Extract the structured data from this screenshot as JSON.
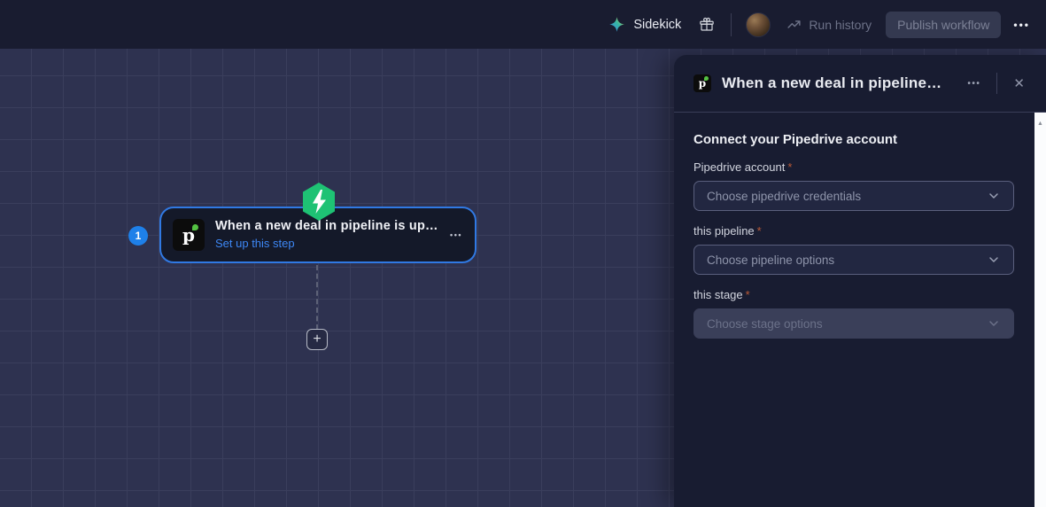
{
  "topbar": {
    "sidekick_label": "Sidekick",
    "run_history_label": "Run history",
    "publish_label": "Publish workflow",
    "more_glyph": "•••"
  },
  "canvas": {
    "add_label": "+",
    "node": {
      "step_number": "1",
      "icon_letter": "p",
      "title": "When a new deal in pipeline is up…",
      "subtitle": "Set up this step",
      "more_glyph": "•••"
    }
  },
  "panel": {
    "icon_letter": "p",
    "title": "When a new deal in pipeline…",
    "more_glyph": "•••",
    "close_glyph": "✕",
    "section_heading": "Connect your Pipedrive account",
    "scroll_up_glyph": "▲",
    "fields": [
      {
        "label": "Pipedrive account",
        "required_mark": "*",
        "placeholder": "Choose pipedrive credentials",
        "disabled": false
      },
      {
        "label": "this pipeline",
        "required_mark": "*",
        "placeholder": "Choose pipeline options",
        "disabled": false
      },
      {
        "label": "this stage",
        "required_mark": "*",
        "placeholder": "Choose stage options",
        "disabled": true
      }
    ]
  },
  "colors": {
    "topbar_bg": "#191c30",
    "canvas_bg": "#2e3250",
    "grid_line": "#3a3e5c",
    "panel_bg": "#181c31",
    "node_border_accent": "#3079e3",
    "link_blue": "#3d87f5",
    "step_badge_blue": "#1e80e9",
    "trigger_badge_green": "#1ec274",
    "required_asterisk": "#bb5a36",
    "scrollbar_track": "#fbfcfd"
  }
}
